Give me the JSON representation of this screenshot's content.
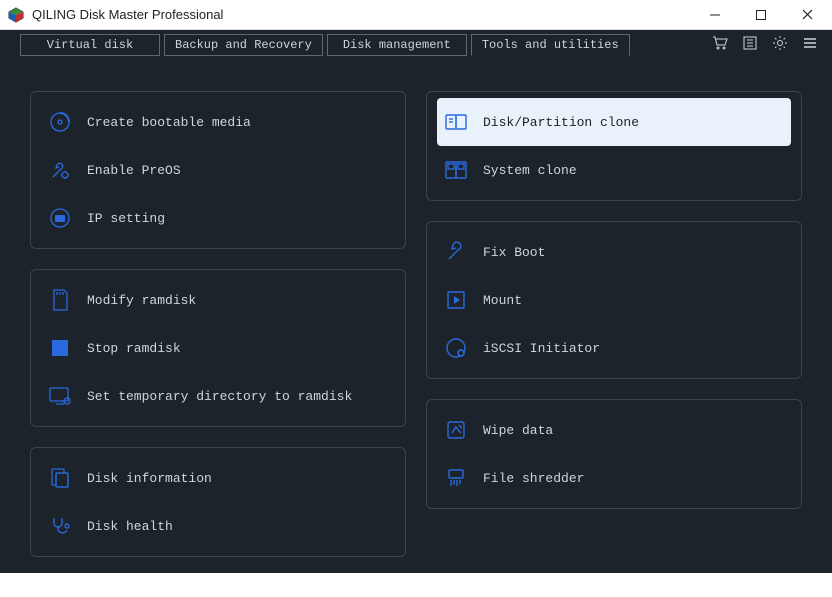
{
  "window": {
    "title": "QILING Disk Master Professional"
  },
  "tabs": {
    "virtual_disk": "Virtual disk",
    "backup_recovery": "Backup and Recovery",
    "disk_management": "Disk management",
    "tools_utilities": "Tools and utilities"
  },
  "left": {
    "group1": {
      "bootable": "Create bootable media",
      "preos": "Enable PreOS",
      "ip": "IP setting"
    },
    "group2": {
      "modify_ramdisk": "Modify ramdisk",
      "stop_ramdisk": "Stop ramdisk",
      "tempdir": "Set temporary directory to ramdisk"
    },
    "group3": {
      "disk_info": "Disk information",
      "disk_health": "Disk health"
    }
  },
  "right": {
    "group1": {
      "partition_clone": "Disk/Partition clone",
      "system_clone": "System clone"
    },
    "group2": {
      "fix_boot": "Fix Boot",
      "mount": "Mount",
      "iscsi": "iSCSI Initiator"
    },
    "group3": {
      "wipe": "Wipe data",
      "shredder": "File shredder"
    }
  }
}
